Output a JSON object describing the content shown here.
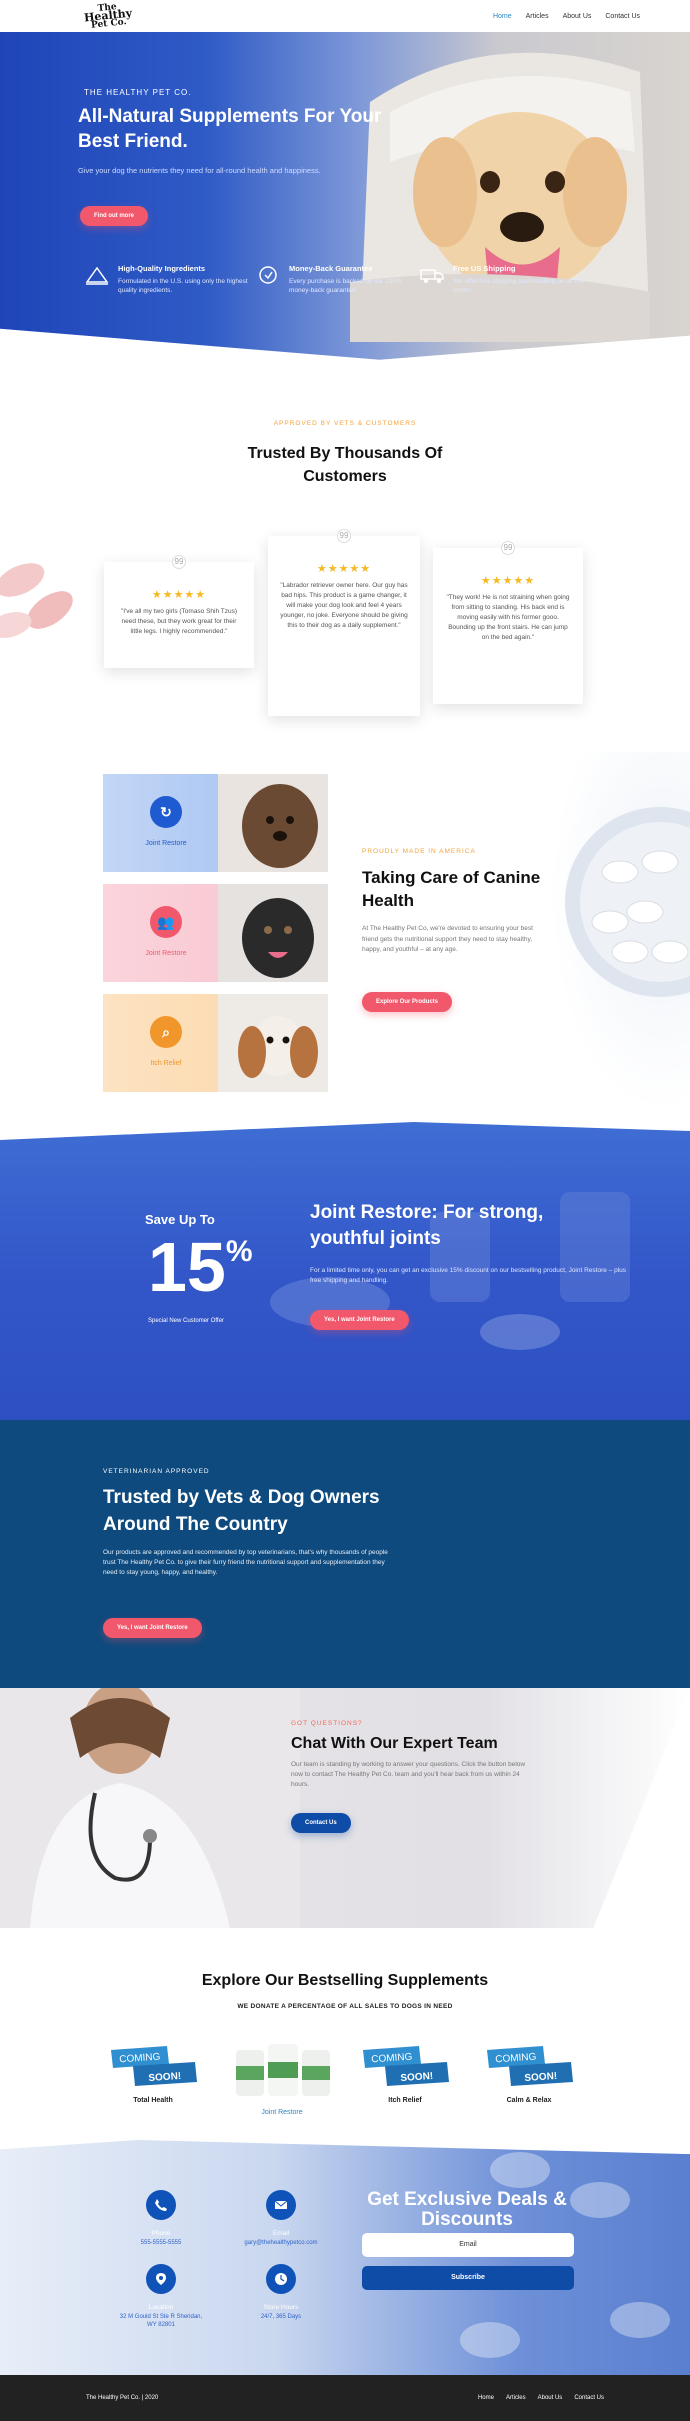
{
  "header": {
    "logo_line1": "The",
    "logo_line2": "Healthy",
    "logo_line3": "Pet Co.",
    "nav": [
      "Home",
      "Articles",
      "About Us",
      "Contact Us"
    ]
  },
  "hero": {
    "kicker": "THE HEALTHY PET CO.",
    "title": "All-Natural Supplements For Your Best Friend.",
    "subtitle": "Give your dog the nutrients they need for all-round health and happiness.",
    "cta": "Find out more",
    "features": [
      {
        "title": "High-Quality Ingredients",
        "text": "Formulated in the U.S. using only the highest quality ingredients."
      },
      {
        "title": "Money-Back Guarantee",
        "text": "Every purchase is backed by our 100% money-back guarantee."
      },
      {
        "title": "Free US Shipping",
        "text": "We offer free shipping and handling on all US orders."
      }
    ]
  },
  "testimonials": {
    "kicker": "APPROVED BY VETS & CUSTOMERS",
    "title": "Trusted By Thousands Of Customers",
    "stars": "★★★★★",
    "quote_mark": "99",
    "items": [
      "\"I've all my two girls (Tomaso Shih Tzus) need these, but they work great for their little legs. I highly recommended.\"",
      "\"Labrador retriever owner here. Our guy has bad hips. This product is a game changer, it will make your dog look and feel 4 years younger, no joke. Everyone should be giving this to their dog as a daily supplement.\"",
      "\"They work! He is not straining when going from sitting to standing. His back end is moving easily with his former gooo. Bounding up the front stairs. He can jump on the bed again.\""
    ]
  },
  "canine": {
    "tiles": [
      {
        "label": "Joint Restore",
        "color": "#1f5bd0",
        "text_color": "#1f5bd0"
      },
      {
        "label": "Joint Restore",
        "color": "#f2586b",
        "text_color": "#f2586b"
      },
      {
        "label": "Itch Relief",
        "color": "#f0962a",
        "text_color": "#f0962a"
      }
    ],
    "kicker": "PROUDLY MADE IN AMERICA",
    "title": "Taking Care of Canine Health",
    "text": "At The Healthy Pet Co, we're devoted to ensuring your best friend gets the nutritional support they need to stay healthy, happy, and youthful – at any age.",
    "cta": "Explore Our Products"
  },
  "promo": {
    "save": "Save Up To",
    "pct": "15",
    "pct_sign": "%",
    "special": "Special New Customer Offer",
    "title": "Joint Restore: For strong, youthful joints",
    "text": "For a limited time only, you can get an exclusive 15% discount on our bestselling product, Joint Restore – plus free shipping and handling.",
    "cta": "Yes, I want Joint Restore"
  },
  "vets": {
    "kicker": "VETERINARIAN APPROVED",
    "title": "Trusted by Vets & Dog Owners Around The Country",
    "text": "Our products are approved and recommended by top veterinarians, that's why thousands of people trust The Healthy Pet Co. to give their furry friend the nutritional support and supplementation they need to stay young, happy, and healthy.",
    "cta": "Yes, I want Joint Restore"
  },
  "expert": {
    "kicker": "GOT QUESTIONS?",
    "title": "Chat With Our Expert Team",
    "text": "Our team is standing by working to answer your questions. Click the button below now to contact The Healthy Pet Co. team and you'll hear back from us within 24 hours.",
    "cta": "Contact Us"
  },
  "bestsellers": {
    "title": "Explore Our Bestselling Supplements",
    "subtitle": "WE DONATE A PERCENTAGE OF ALL SALES TO DOGS IN NEED",
    "coming": "COMING",
    "soon": "SOON!",
    "products": [
      "Total Health",
      "Joint Restore",
      "Itch Relief",
      "Calm & Relax"
    ]
  },
  "deals": {
    "contacts": [
      {
        "label": "Phone",
        "value": "555-5555-5555"
      },
      {
        "label": "Email",
        "value": "gary@thehealthypetco.com"
      },
      {
        "label": "Location",
        "value": "32 M Gould St Ste R Sheridan, WY 82801"
      },
      {
        "label": "Store Hours",
        "value": "24/7, 365 Days"
      }
    ],
    "title": "Get Exclusive Deals & Discounts",
    "email_placeholder": "Email",
    "subscribe": "Subscribe"
  },
  "footer": {
    "copyright": "The Healthy Pet Co. | 2020",
    "links": [
      "Home",
      "Articles",
      "About Us",
      "Contact Us"
    ]
  }
}
